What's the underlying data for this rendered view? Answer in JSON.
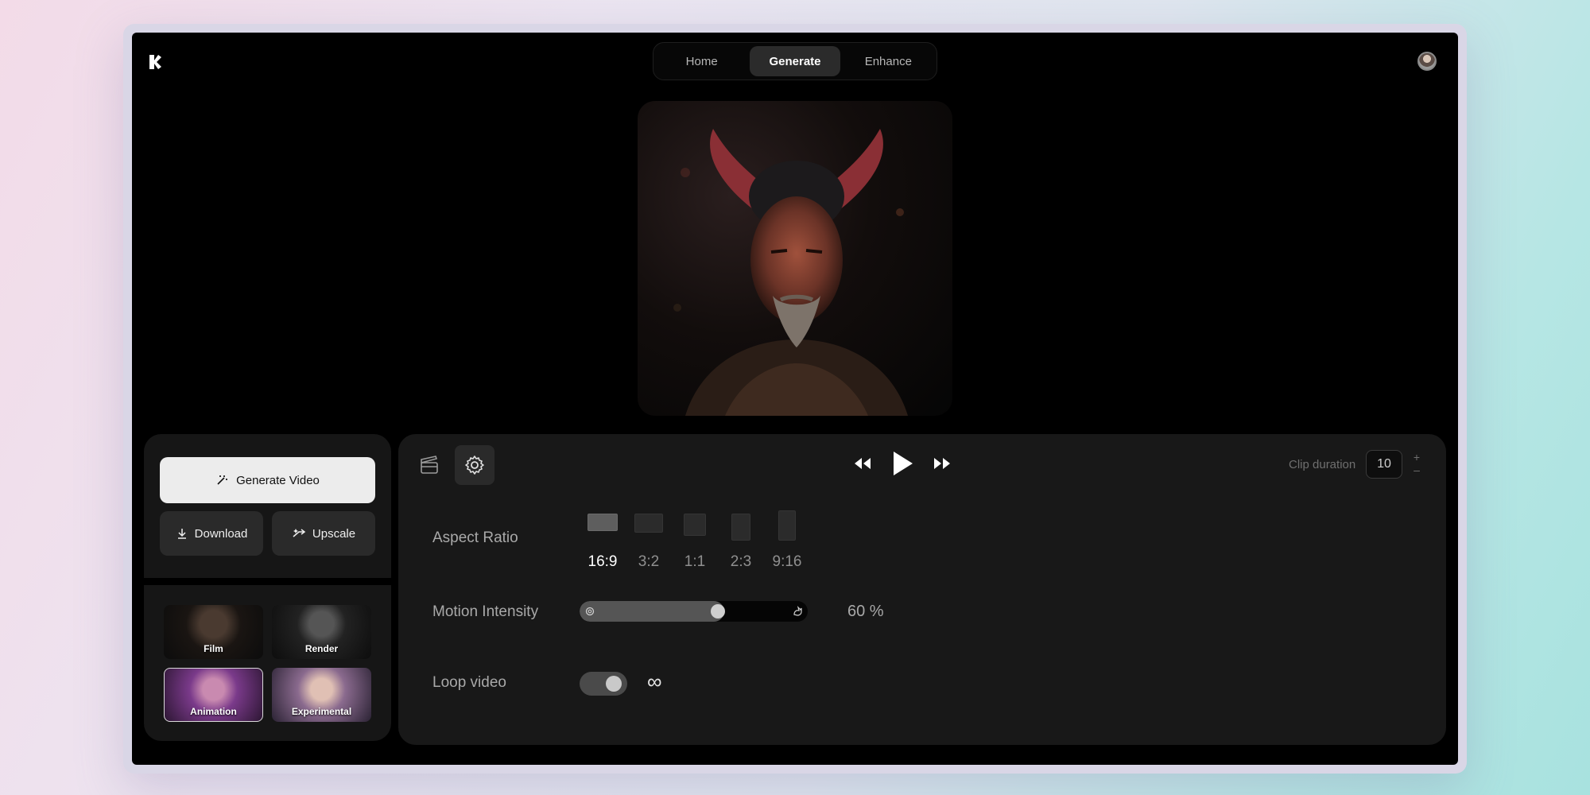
{
  "nav": {
    "tabs": [
      {
        "label": "Home",
        "active": false
      },
      {
        "label": "Generate",
        "active": true
      },
      {
        "label": "Enhance",
        "active": false
      }
    ]
  },
  "actions": {
    "generate_label": "Generate Video",
    "download_label": "Download",
    "upscale_label": "Upscale"
  },
  "styles": [
    {
      "label": "Film",
      "selected": false
    },
    {
      "label": "Render",
      "selected": false
    },
    {
      "label": "Animation",
      "selected": true
    },
    {
      "label": "Experimental",
      "selected": false
    }
  ],
  "clip": {
    "label": "Clip duration",
    "value": "10",
    "plus": "+",
    "minus": "–"
  },
  "aspect": {
    "label": "Aspect Ratio",
    "options": [
      "16:9",
      "3:2",
      "1:1",
      "2:3",
      "9:16"
    ],
    "selected": "16:9"
  },
  "motion": {
    "label": "Motion Intensity",
    "value": 60,
    "display": "60 %"
  },
  "loop": {
    "label": "Loop video",
    "enabled": true,
    "symbol": "∞"
  },
  "colors": {
    "accent": "#ececec",
    "panel": "#181818",
    "background": "#000000"
  }
}
